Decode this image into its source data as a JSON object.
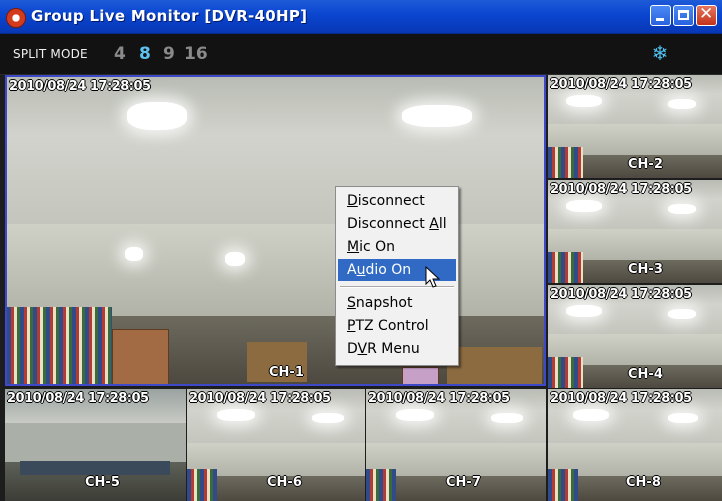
{
  "window": {
    "title": "Group Live Monitor [DVR-40HP]"
  },
  "toolbar": {
    "split_label": "SPLIT MODE",
    "split_options": [
      "4",
      "8",
      "9",
      "16"
    ],
    "selected_split": "8",
    "accent_color": "#5ec3f0"
  },
  "channels": [
    {
      "id": "CH-1",
      "label": "CH-1",
      "timestamp": "2010/08/24 17:28:05"
    },
    {
      "id": "CH-2",
      "label": "CH-2",
      "timestamp": "2010/08/24 17:28:05"
    },
    {
      "id": "CH-3",
      "label": "CH-3",
      "timestamp": "2010/08/24 17:28:05"
    },
    {
      "id": "CH-4",
      "label": "CH-4",
      "timestamp": "2010/08/24 17:28:05"
    },
    {
      "id": "CH-5",
      "label": "CH-5",
      "timestamp": "2010/08/24 17:28:05"
    },
    {
      "id": "CH-6",
      "label": "CH-6",
      "timestamp": "2010/08/24 17:28:05"
    },
    {
      "id": "CH-7",
      "label": "CH-7",
      "timestamp": "2010/08/24 17:28:05"
    },
    {
      "id": "CH-8",
      "label": "CH-8",
      "timestamp": "2010/08/24 17:28:05"
    }
  ],
  "context_menu": {
    "items": [
      {
        "pre": "",
        "key": "D",
        "post": "isconnect"
      },
      {
        "pre": "Disconnect ",
        "key": "A",
        "post": "ll"
      },
      {
        "pre": "",
        "key": "M",
        "post": "ic On"
      },
      {
        "pre": "A",
        "key": "u",
        "post": "dio On"
      },
      {
        "pre": "",
        "key": "S",
        "post": "napshot"
      },
      {
        "pre": "",
        "key": "P",
        "post": "TZ Control"
      },
      {
        "pre": "D",
        "key": "V",
        "post": "R Menu"
      }
    ],
    "highlighted": "Audio On",
    "highlight_color": "#316ac5"
  },
  "icons": {
    "app": "dvr-app-icon",
    "snow": "snowflake-icon",
    "cursor": "mouse-pointer-icon"
  }
}
